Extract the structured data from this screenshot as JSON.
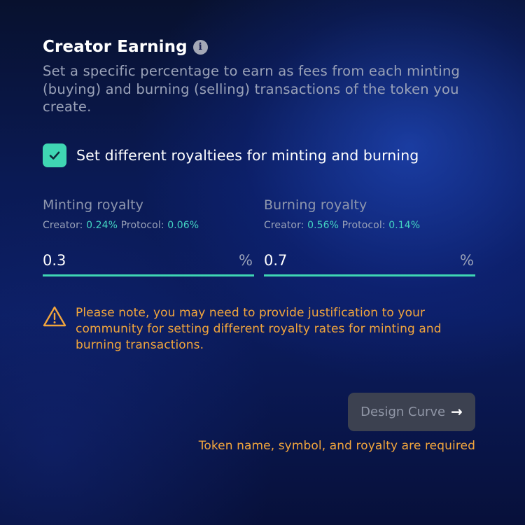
{
  "section": {
    "title": "Creator Earning",
    "info_icon": "info-icon",
    "description": "Set a specific percentage to earn as fees from each minting (buying) and burning (selling) transactions of the token you create."
  },
  "checkbox": {
    "checked": true,
    "label": "Set different royaltiees for minting and burning",
    "color": "#3fd6b3"
  },
  "minting": {
    "title": "Minting royalty",
    "creator_label": "Creator:",
    "creator_value": "0.24%",
    "protocol_label": "Protocol:",
    "protocol_value": "0.06%",
    "input_value": "0.3",
    "unit": "%"
  },
  "burning": {
    "title": "Burning royalty",
    "creator_label": "Creator:",
    "creator_value": "0.56%",
    "protocol_label": "Protocol:",
    "protocol_value": "0.14%",
    "input_value": "0.7",
    "unit": "%"
  },
  "warning": {
    "icon": "warning-triangle-icon",
    "text": "Please note, you may need to provide justification to your community for setting different royalty rates for minting and burning transactions.",
    "color": "#f3a63c"
  },
  "design_button": {
    "label": "Design Curve",
    "icon": "arrow-right-icon",
    "disabled": true
  },
  "required_message": "Token name, symbol, and royalty are required",
  "colors": {
    "accent": "#3fd6b3",
    "warning": "#f3a63c",
    "muted_text": "#9aa2b8"
  }
}
